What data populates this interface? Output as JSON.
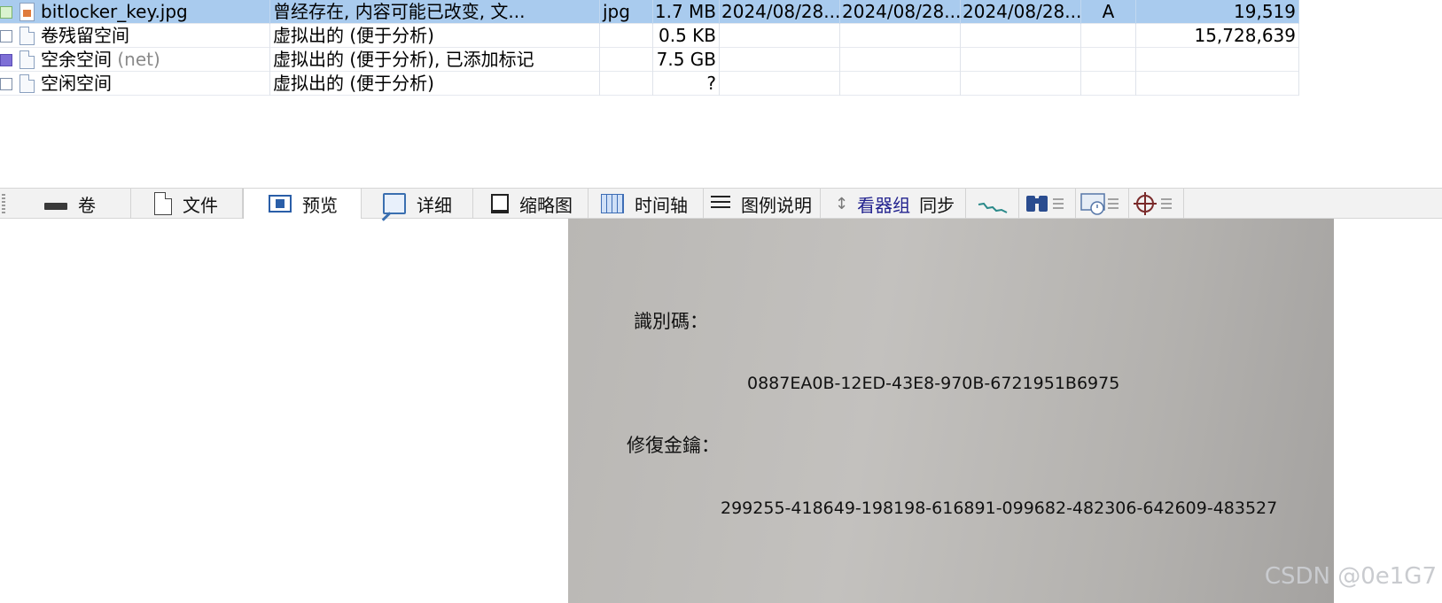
{
  "file_list": {
    "rows": [
      {
        "name": "bitlocker_key.jpg",
        "desc": "曾经存在, 内容可能已改变, 文...",
        "type": "jpg",
        "size": "1.7 MB",
        "created": "2024/08/28...",
        "modified": "2024/08/28...",
        "accessed": "2024/08/28...",
        "attr": "A",
        "sector": "19,519"
      },
      {
        "name": "卷残留空间",
        "desc": "虚拟出的 (便于分析)",
        "size": "0.5 KB",
        "sector": "15,728,639"
      },
      {
        "name": "空余空间",
        "name_suffix": "(net)",
        "desc": "虚拟出的 (便于分析), 已添加标记",
        "size": "7.5 GB"
      },
      {
        "name": "空闲空间",
        "desc": "虚拟出的 (便于分析)",
        "size": "?"
      }
    ]
  },
  "tabs": {
    "volume": "卷",
    "file": "文件",
    "preview": "预览",
    "details": "详细",
    "thumbnail": "缩略图",
    "timeline": "时间轴",
    "legend": "图例说明",
    "viewer_group": "看器组",
    "sync": "同步"
  },
  "preview_image": {
    "id_label": "識別碼：",
    "id_value": "0887EA0B-12ED-43E8-970B-6721951B6975",
    "recovery_label": "修復金鑰：",
    "recovery_value": "299255-418649-198198-616891-099682-482306-642609-483527"
  },
  "watermark": "CSDN @0e1G7"
}
